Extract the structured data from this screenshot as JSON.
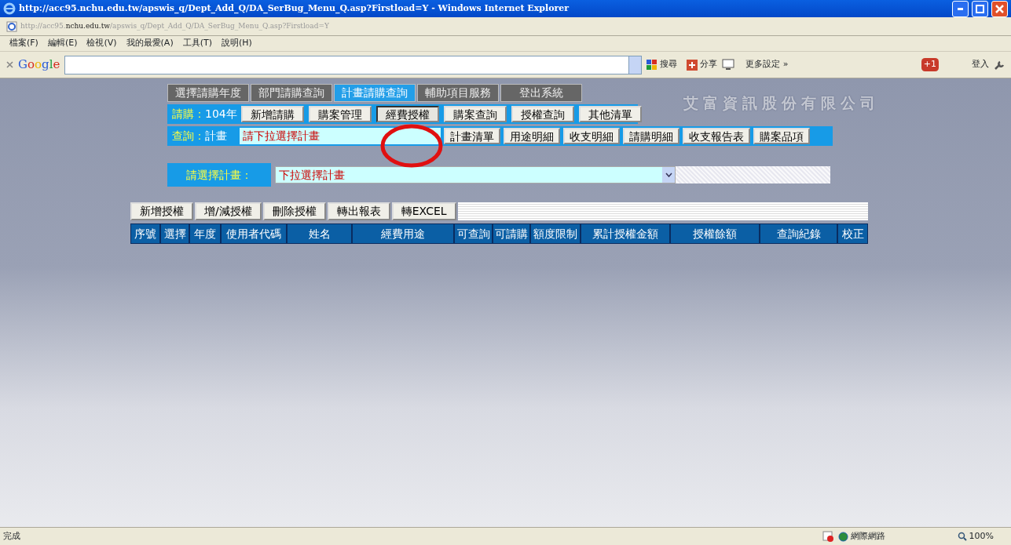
{
  "window": {
    "title": "http://acc95.nchu.edu.tw/apswis_q/Dept_Add_Q/DA_SerBug_Menu_Q.asp?Firstload=Y - Windows Internet Explorer"
  },
  "address_bar": {
    "url": "http://acc95.**nchu.edu.tw**/apswis_q/Dept_Add_Q/DA_SerBug_Menu_Q.asp?Firstload=Y"
  },
  "menu_bar": [
    "檔案(F)",
    "編輯(E)",
    "檢視(V)",
    "我的最愛(A)",
    "工具(T)",
    "說明(H)"
  ],
  "google_toolbar": {
    "logo": "Google",
    "search": "搜尋",
    "share": "分享",
    "more": "更多設定 »",
    "plus_one": "+1",
    "sign_in": "登入"
  },
  "page": {
    "company_name": "艾富資訊股份有限公司",
    "nav_tabs": [
      {
        "label": "選擇請購年度",
        "selected": false
      },
      {
        "label": "部門請購查詢",
        "selected": false
      },
      {
        "label": "計畫請購查詢",
        "selected": true
      },
      {
        "label": "輔助項目服務",
        "selected": false
      },
      {
        "label": "登出系統",
        "selected": false
      }
    ],
    "purchase_row": {
      "label": "請購：",
      "year": "104年",
      "buttons": [
        {
          "label": "新增請購",
          "selected": false
        },
        {
          "label": "購案管理",
          "selected": false
        },
        {
          "label": "經費授權",
          "selected": true
        },
        {
          "label": "購案查詢",
          "selected": false
        },
        {
          "label": "授權查詢",
          "selected": false
        },
        {
          "label": "其他清單",
          "selected": false
        }
      ]
    },
    "query_row": {
      "label": "查詢：",
      "scope": "計畫",
      "field_value": "請下拉選擇計畫",
      "buttons": [
        "計畫清單",
        "用途明細",
        "收支明細",
        "請購明細",
        "收支報告表",
        "購案品項"
      ]
    },
    "plan_select": {
      "label": "請選擇計畫：",
      "value": "下拉選擇計畫"
    },
    "action_buttons": [
      "新增授權",
      "增/減授權",
      "刪除授權",
      "轉出報表",
      "轉EXCEL"
    ],
    "table": {
      "columns": [
        "序號",
        "選擇",
        "年度",
        "使用者代碼",
        "姓名",
        "經費用途",
        "可查詢",
        "可請購",
        "額度限制",
        "累計授權金額",
        "授權餘額",
        "查詢紀錄",
        "校正"
      ]
    },
    "annotations": [
      {
        "kind": "circle",
        "color": "#e01010"
      }
    ]
  },
  "status_bar": {
    "text": "完成",
    "zone": "網際網路",
    "zoom": "100%"
  }
}
